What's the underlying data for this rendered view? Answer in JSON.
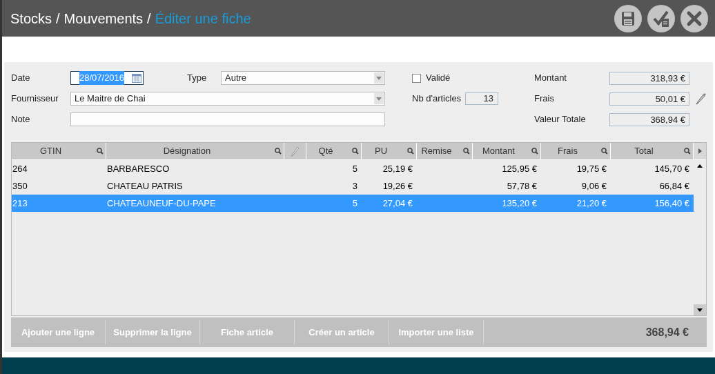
{
  "breadcrumb": {
    "items": [
      "Stocks",
      "Mouvements"
    ],
    "separator": "/",
    "current": "Éditer une fiche"
  },
  "toolbar": [
    {
      "kind": "save"
    },
    {
      "kind": "validate"
    },
    {
      "kind": "close"
    }
  ],
  "form": {
    "date": {
      "label": "Date",
      "value": "28/07/2016",
      "focused": true
    },
    "type": {
      "label": "Type",
      "value": "Autre"
    },
    "fournisseur": {
      "label": "Fournisseur",
      "value": "Le Maitre de Chai"
    },
    "note": {
      "label": "Note"
    },
    "valide": {
      "label": "Validé",
      "checked": false
    },
    "nb_articles": {
      "label": "Nb d'articles",
      "value": "13"
    },
    "montant": {
      "label": "Montant",
      "value": "318,93 €"
    },
    "frais": {
      "label": "Frais",
      "value": "50,01 €"
    },
    "valeur_totale": {
      "label": "Valeur Totale",
      "value": "368,94 €"
    }
  },
  "table": {
    "columns": [
      {
        "label": "GTIN",
        "kind": "search"
      },
      {
        "label": "Désignation",
        "kind": "search"
      },
      {
        "kind": "edit"
      },
      {
        "label": "Qté",
        "kind": "search"
      },
      {
        "label": "PU",
        "kind": "search"
      },
      {
        "label": "Remise",
        "kind": "search"
      },
      {
        "label": "Montant",
        "kind": "search"
      },
      {
        "label": "Frais",
        "kind": "search"
      },
      {
        "label": "Total",
        "kind": "search"
      }
    ],
    "rows": [
      {
        "selected": false,
        "cells": [
          "264",
          "BARBARESCO",
          null,
          "5",
          "25,19 €",
          null,
          "125,95 €",
          "19,75 €",
          "145,70 €"
        ]
      },
      {
        "selected": false,
        "cells": [
          "350",
          "CHATEAU PATRIS",
          null,
          "3",
          "19,26 €",
          null,
          "57,78 €",
          "9,06 €",
          "66,84 €"
        ]
      },
      {
        "selected": true,
        "cells": [
          "213",
          "CHATEAUNEUF-DU-PAPE",
          null,
          "5",
          "27,04 €",
          null,
          "135,20 €",
          "21,20 €",
          "156,40 €"
        ]
      }
    ]
  },
  "actions": [
    "Ajouter une ligne",
    "Supprimer la ligne",
    "Fiche article",
    "Créer un article",
    "Importer une liste"
  ],
  "total": "368,94 €"
}
